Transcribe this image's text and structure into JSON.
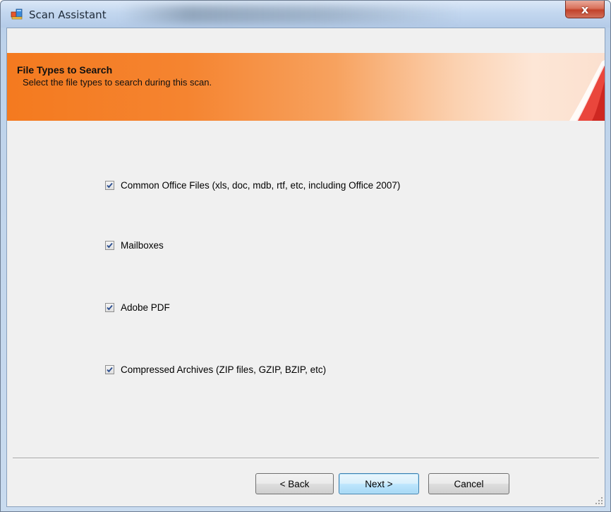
{
  "window": {
    "title": "Scan Assistant",
    "close_label": "x"
  },
  "banner": {
    "title": "File Types to Search",
    "subtitle": "Select the file types to search during this scan."
  },
  "options": [
    {
      "label": "Common Office Files (xls, doc, mdb, rtf, etc, including Office 2007)",
      "checked": true
    },
    {
      "label": "Mailboxes",
      "checked": true
    },
    {
      "label": "Adobe PDF",
      "checked": true
    },
    {
      "label": "Compressed Archives (ZIP files, GZIP, BZIP, etc)",
      "checked": true
    }
  ],
  "buttons": {
    "back": "< Back",
    "next": "Next >",
    "cancel": "Cancel"
  },
  "colors": {
    "banner_orange": "#f47a1f",
    "default_button_border": "#3c7fb1",
    "checkmark": "#2a4d8f"
  }
}
